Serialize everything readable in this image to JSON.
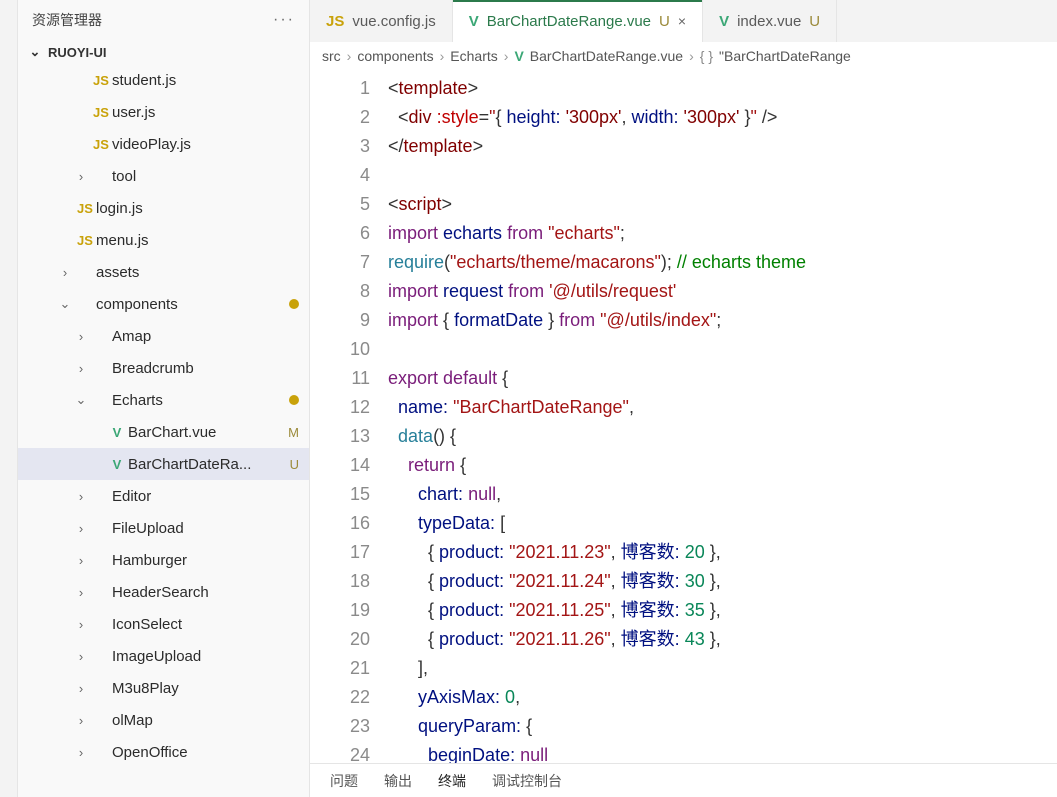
{
  "sidebar": {
    "header_title": "资源管理器",
    "root_label": "RUOYI-UI",
    "tree": [
      {
        "indent": 54,
        "chev": "",
        "icon": "JS",
        "icon_cls": "js",
        "label": "student.js",
        "badge": "",
        "sel": false
      },
      {
        "indent": 54,
        "chev": "",
        "icon": "JS",
        "icon_cls": "js",
        "label": "user.js",
        "badge": "",
        "sel": false
      },
      {
        "indent": 54,
        "chev": "",
        "icon": "JS",
        "icon_cls": "js",
        "label": "videoPlay.js",
        "badge": "",
        "sel": false
      },
      {
        "indent": 54,
        "chev": "›",
        "icon": "",
        "icon_cls": "",
        "label": "tool",
        "badge": "",
        "sel": false
      },
      {
        "indent": 38,
        "chev": "",
        "icon": "JS",
        "icon_cls": "js",
        "label": "login.js",
        "badge": "",
        "sel": false
      },
      {
        "indent": 38,
        "chev": "",
        "icon": "JS",
        "icon_cls": "js",
        "label": "menu.js",
        "badge": "",
        "sel": false
      },
      {
        "indent": 38,
        "chev": "›",
        "icon": "",
        "icon_cls": "",
        "label": "assets",
        "badge": "",
        "sel": false
      },
      {
        "indent": 38,
        "chev": "⌄",
        "icon": "",
        "icon_cls": "",
        "label": "components",
        "badge": "•",
        "sel": false
      },
      {
        "indent": 54,
        "chev": "›",
        "icon": "",
        "icon_cls": "",
        "label": "Amap",
        "badge": "",
        "sel": false
      },
      {
        "indent": 54,
        "chev": "›",
        "icon": "",
        "icon_cls": "",
        "label": "Breadcrumb",
        "badge": "",
        "sel": false
      },
      {
        "indent": 54,
        "chev": "⌄",
        "icon": "",
        "icon_cls": "",
        "label": "Echarts",
        "badge": "•",
        "sel": false
      },
      {
        "indent": 70,
        "chev": "",
        "icon": "V",
        "icon_cls": "vue",
        "label": "BarChart.vue",
        "badge": "M",
        "sel": false
      },
      {
        "indent": 70,
        "chev": "",
        "icon": "V",
        "icon_cls": "vue",
        "label": "BarChartDateRa...",
        "badge": "U",
        "sel": true
      },
      {
        "indent": 54,
        "chev": "›",
        "icon": "",
        "icon_cls": "",
        "label": "Editor",
        "badge": "",
        "sel": false
      },
      {
        "indent": 54,
        "chev": "›",
        "icon": "",
        "icon_cls": "",
        "label": "FileUpload",
        "badge": "",
        "sel": false
      },
      {
        "indent": 54,
        "chev": "›",
        "icon": "",
        "icon_cls": "",
        "label": "Hamburger",
        "badge": "",
        "sel": false
      },
      {
        "indent": 54,
        "chev": "›",
        "icon": "",
        "icon_cls": "",
        "label": "HeaderSearch",
        "badge": "",
        "sel": false
      },
      {
        "indent": 54,
        "chev": "›",
        "icon": "",
        "icon_cls": "",
        "label": "IconSelect",
        "badge": "",
        "sel": false
      },
      {
        "indent": 54,
        "chev": "›",
        "icon": "",
        "icon_cls": "",
        "label": "ImageUpload",
        "badge": "",
        "sel": false
      },
      {
        "indent": 54,
        "chev": "›",
        "icon": "",
        "icon_cls": "",
        "label": "M3u8Play",
        "badge": "",
        "sel": false
      },
      {
        "indent": 54,
        "chev": "›",
        "icon": "",
        "icon_cls": "",
        "label": "olMap",
        "badge": "",
        "sel": false
      },
      {
        "indent": 54,
        "chev": "›",
        "icon": "",
        "icon_cls": "",
        "label": "OpenOffice",
        "badge": "",
        "sel": false
      }
    ]
  },
  "tabs": [
    {
      "icon": "JS",
      "icon_cls": "js",
      "label": "vue.config.js",
      "suffix": "",
      "close": "",
      "active": false
    },
    {
      "icon": "V",
      "icon_cls": "vue",
      "label": "BarChartDateRange.vue",
      "suffix": "U",
      "close": "×",
      "active": true
    },
    {
      "icon": "V",
      "icon_cls": "vue",
      "label": "index.vue",
      "suffix": "U",
      "close": "",
      "active": false
    }
  ],
  "crumbs": {
    "p1": "src",
    "p2": "components",
    "p3": "Echarts",
    "p4": "BarChartDateRange.vue",
    "p5": "\"BarChartDateRange"
  },
  "code": {
    "lines": [
      1,
      2,
      3,
      4,
      5,
      6,
      7,
      8,
      9,
      10,
      11,
      12,
      13,
      14,
      15,
      16,
      17,
      18,
      19,
      20,
      21,
      22,
      23,
      24
    ],
    "l2_style": ":style",
    "l2_height": "'300px'",
    "l2_width": "'300px'",
    "l6_echarts": "echarts",
    "l6_from": "\"echarts\"",
    "l7_req": "\"echarts/theme/macarons\"",
    "l7_cmt": "// echarts theme",
    "l8_req": "request",
    "l8_from": "'@/utils/request'",
    "l9_fd": "formatDate",
    "l9_from": "\"@/utils/index\"",
    "l12_name": "\"BarChartDateRange\"",
    "dates": [
      "\"2021.11.23\"",
      "\"2021.11.24\"",
      "\"2021.11.25\"",
      "\"2021.11.26\""
    ],
    "nums": [
      "20",
      "30",
      "35",
      "43"
    ],
    "blog": "博客数"
  },
  "panel": {
    "t1": "问题",
    "t2": "输出",
    "t3": "终端",
    "t4": "调试控制台"
  }
}
